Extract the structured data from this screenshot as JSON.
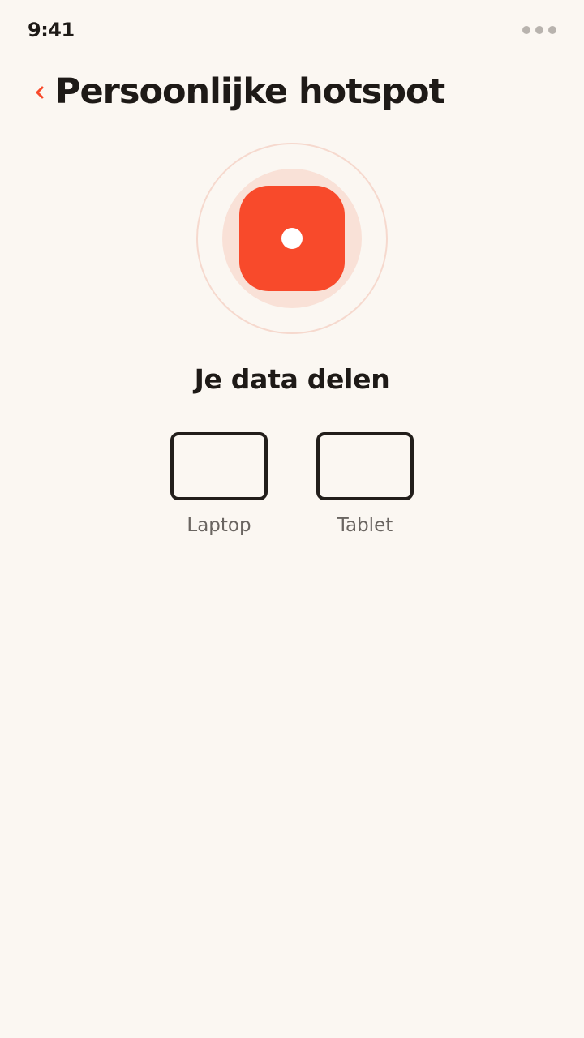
{
  "status_bar": {
    "time": "9:41"
  },
  "header": {
    "back_icon": "chevron-left-icon",
    "title": "Persoonlijke hotspot"
  },
  "hotspot": {
    "icon": "hotspot-icon",
    "accent_color": "#F84A2B",
    "heading": "Je data delen"
  },
  "devices": [
    {
      "label": "Laptop",
      "icon": "laptop-icon"
    },
    {
      "label": "Tablet",
      "icon": "tablet-icon"
    }
  ],
  "colors": {
    "background": "#FBF7F2",
    "text": "#1E1A17",
    "muted_text": "#6A6561",
    "ring": "#F9E1D7"
  }
}
